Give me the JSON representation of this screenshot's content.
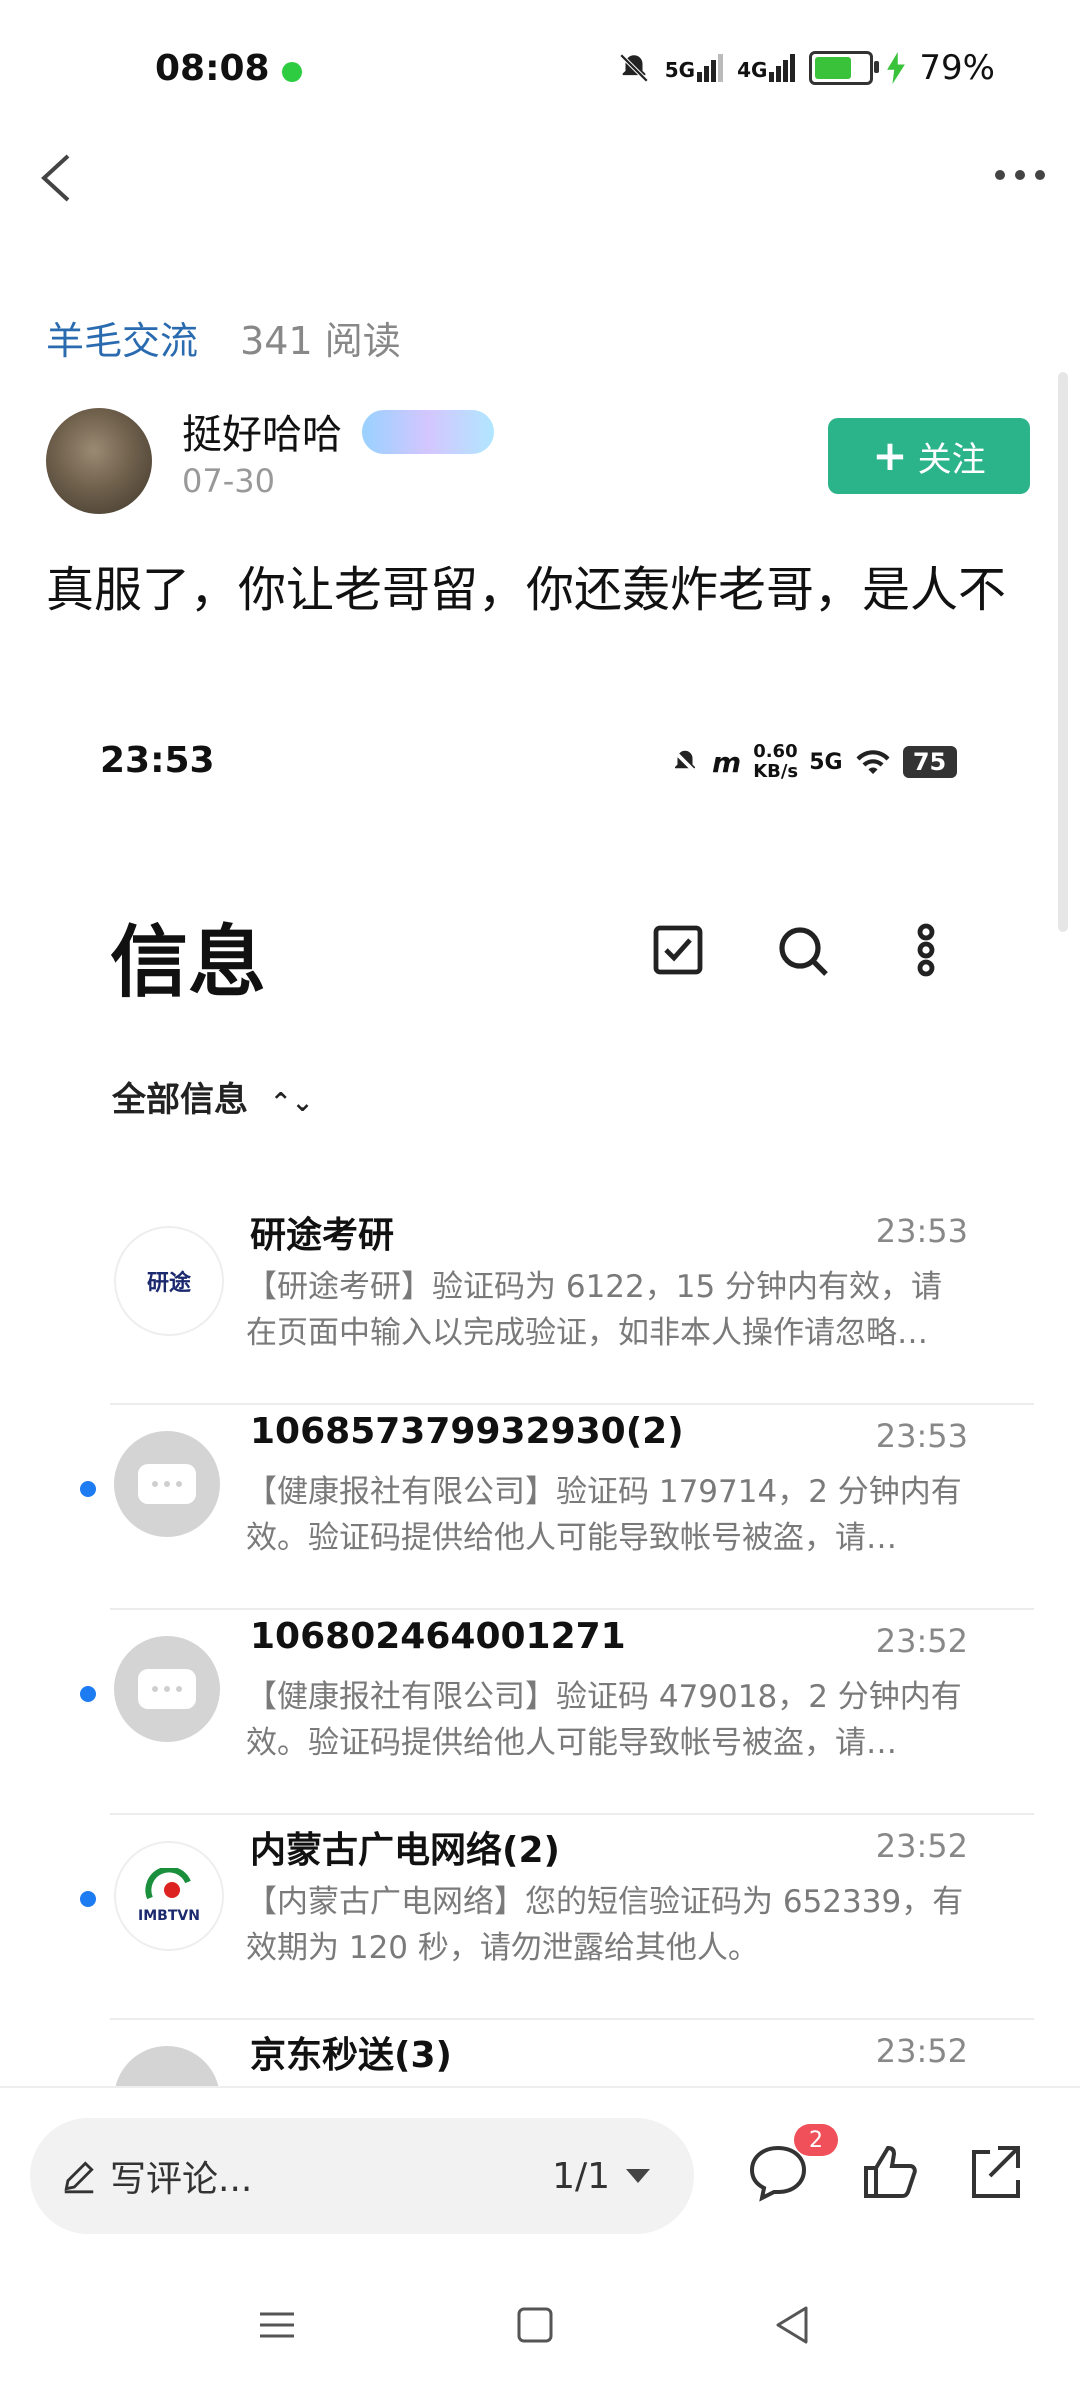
{
  "status_bar": {
    "time": "08:08",
    "network1": "5G",
    "network2": "4G",
    "battery": "79%",
    "battery_level": 0.79
  },
  "post": {
    "topic": "羊毛交流",
    "reads": "341 阅读",
    "author": "挺好哈哈",
    "date": "07-30",
    "follow_label": "关注",
    "text": "真服了，你让老哥留，你还轰炸老哥，是人不"
  },
  "embedded": {
    "time": "23:53",
    "speed": "0.60 KB/s",
    "network": "5G",
    "battery": "75",
    "title": "信息",
    "filter": "全部信息",
    "messages": [
      {
        "name": "研途考研",
        "time": "23:53",
        "preview": "【研途考研】验证码为 6122，15 分钟内有效，请在页面中输入以完成验证，如非本人操作请忽略…",
        "logo_text": "研途",
        "unread": false
      },
      {
        "name": "106857379932930(2)",
        "time": "23:53",
        "preview": "【健康报社有限公司】验证码 179714，2 分钟内有效。验证码提供给他人可能导致帐号被盗，请…",
        "unread": true
      },
      {
        "name": "106802464001271",
        "time": "23:52",
        "preview": "【健康报社有限公司】验证码 479018，2 分钟内有效。验证码提供给他人可能导致帐号被盗，请…",
        "unread": true
      },
      {
        "name": "内蒙古广电网络(2)",
        "time": "23:52",
        "preview": "【内蒙古广电网络】您的短信验证码为 652339，有效期为 120 秒，请勿泄露给其他人。",
        "logo_text": "IMBTVN",
        "unread": true
      },
      {
        "name": "京东秒送(3)",
        "time": "23:52",
        "preview": "",
        "unread": true
      }
    ]
  },
  "bottom": {
    "comment_placeholder": "写评论...",
    "page": "1/1",
    "comment_count": "2"
  }
}
